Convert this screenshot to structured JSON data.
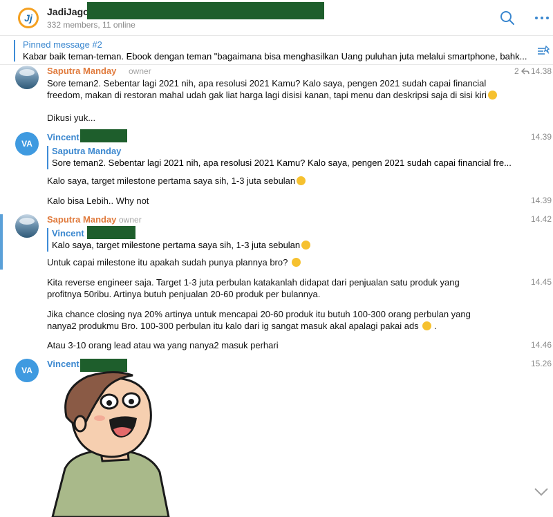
{
  "header": {
    "title": "JadiJago",
    "subtitle": "332 members, 11 online",
    "avatar_letter": "Jj"
  },
  "pinned": {
    "title": "Pinned message #2",
    "text": "Kabar baik teman-teman. Ebook dengan teman \"bagaimana bisa menghasilkan Uang puluhan juta melalui smartphone, bahk..."
  },
  "messages": [
    {
      "sender": "Saputra Manday",
      "role": "owner",
      "time": "14.38",
      "forward_count": "2",
      "lines": [
        "Sore teman2. Sebentar lagi 2021 nih, apa resolusi 2021 Kamu? Kalo saya, pengen 2021 sudah capai financial",
        "freedom, makan di restoran mahal udah gak liat harga lagi disisi kanan, tapi menu dan deskripsi saja di sisi kiri"
      ],
      "extra": "Dikusi yuk..."
    },
    {
      "sender": "Vincent",
      "avatar": "VA",
      "time": "14.39",
      "reply_name": "Saputra Manday",
      "reply_text": "Sore teman2. Sebentar lagi 2021 nih, apa resolusi 2021 Kamu? Kalo saya, pengen 2021 sudah capai financial fre...",
      "text": "Kalo saya, target milestone pertama saya sih, 1-3 juta sebulan",
      "followup": "Kalo bisa Lebih.. Why not",
      "followup_time": "14.39"
    },
    {
      "sender": "Saputra Manday",
      "role": "owner",
      "time": "14.42",
      "reply_name": "Vincent",
      "reply_text": "Kalo saya, target milestone pertama saya sih, 1-3 juta sebulan",
      "text": "Untuk capai milestone itu apakah sudah punya plannya bro?",
      "para1": [
        "Kita reverse engineer saja. Target 1-3 juta perbulan katakanlah didapat dari penjualan satu produk yang",
        "profitnya 50ribu. Artinya butuh penjualan 20-60 produk per bulannya."
      ],
      "para1_time": "14.45",
      "para2": [
        "Jika chance closing nya 20% artinya untuk mencapai 20-60 produk itu butuh 100-300 orang perbulan yang",
        "nanya2 produkmu Bro. 100-300 perbulan itu kalo dari ig sangat masuk akal apalagi pakai ads"
      ],
      "para2_suffix": ".",
      "para3": "Atau 3-10 orang lead atau wa yang nanya2 masuk perhari",
      "para3_time": "14.46"
    },
    {
      "sender": "Vincent",
      "avatar": "VA",
      "time": "15.26"
    }
  ],
  "colors": {
    "accent": "#3a87cf",
    "owner_name": "#e07a3c",
    "redaction": "#1e5e2c"
  },
  "icons": [
    "search-icon",
    "more-icon",
    "pin-list-icon",
    "reply-arrow-icon",
    "scroll-down-icon"
  ]
}
